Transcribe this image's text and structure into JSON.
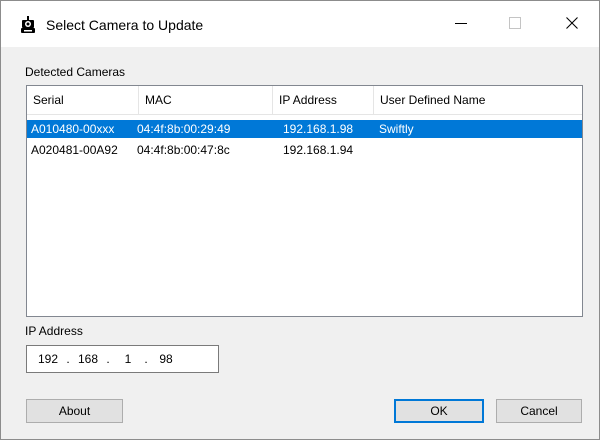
{
  "window": {
    "title": "Select Camera to Update",
    "icon": "camera-robot-icon"
  },
  "caption_buttons": {
    "minimize_icon": "minimize-icon",
    "maximize_icon": "maximize-icon",
    "close_icon": "close-icon"
  },
  "cameras": {
    "group_label": "Detected Cameras",
    "columns": [
      "Serial",
      "MAC",
      "IP Address",
      "User Defined Name"
    ],
    "rows": [
      {
        "serial": "A010480-00xxx",
        "mac": "04:4f:8b:00:29:49",
        "ip": "192.168.1.98",
        "name": "Swiftly",
        "selected": true
      },
      {
        "serial": "A020481-00A92",
        "mac": "04:4f:8b:00:47:8c",
        "ip": "192.168.1.94",
        "name": "",
        "selected": false
      }
    ]
  },
  "ip_address": {
    "label": "IP Address",
    "octets": [
      "192",
      "168",
      "1",
      "98"
    ],
    "separator": "."
  },
  "buttons": {
    "about": "About",
    "ok": "OK",
    "cancel": "Cancel"
  },
  "colors": {
    "selection": "#0078d7",
    "button_face": "#e1e1e1",
    "dialog_bg": "#f0f0f0"
  }
}
